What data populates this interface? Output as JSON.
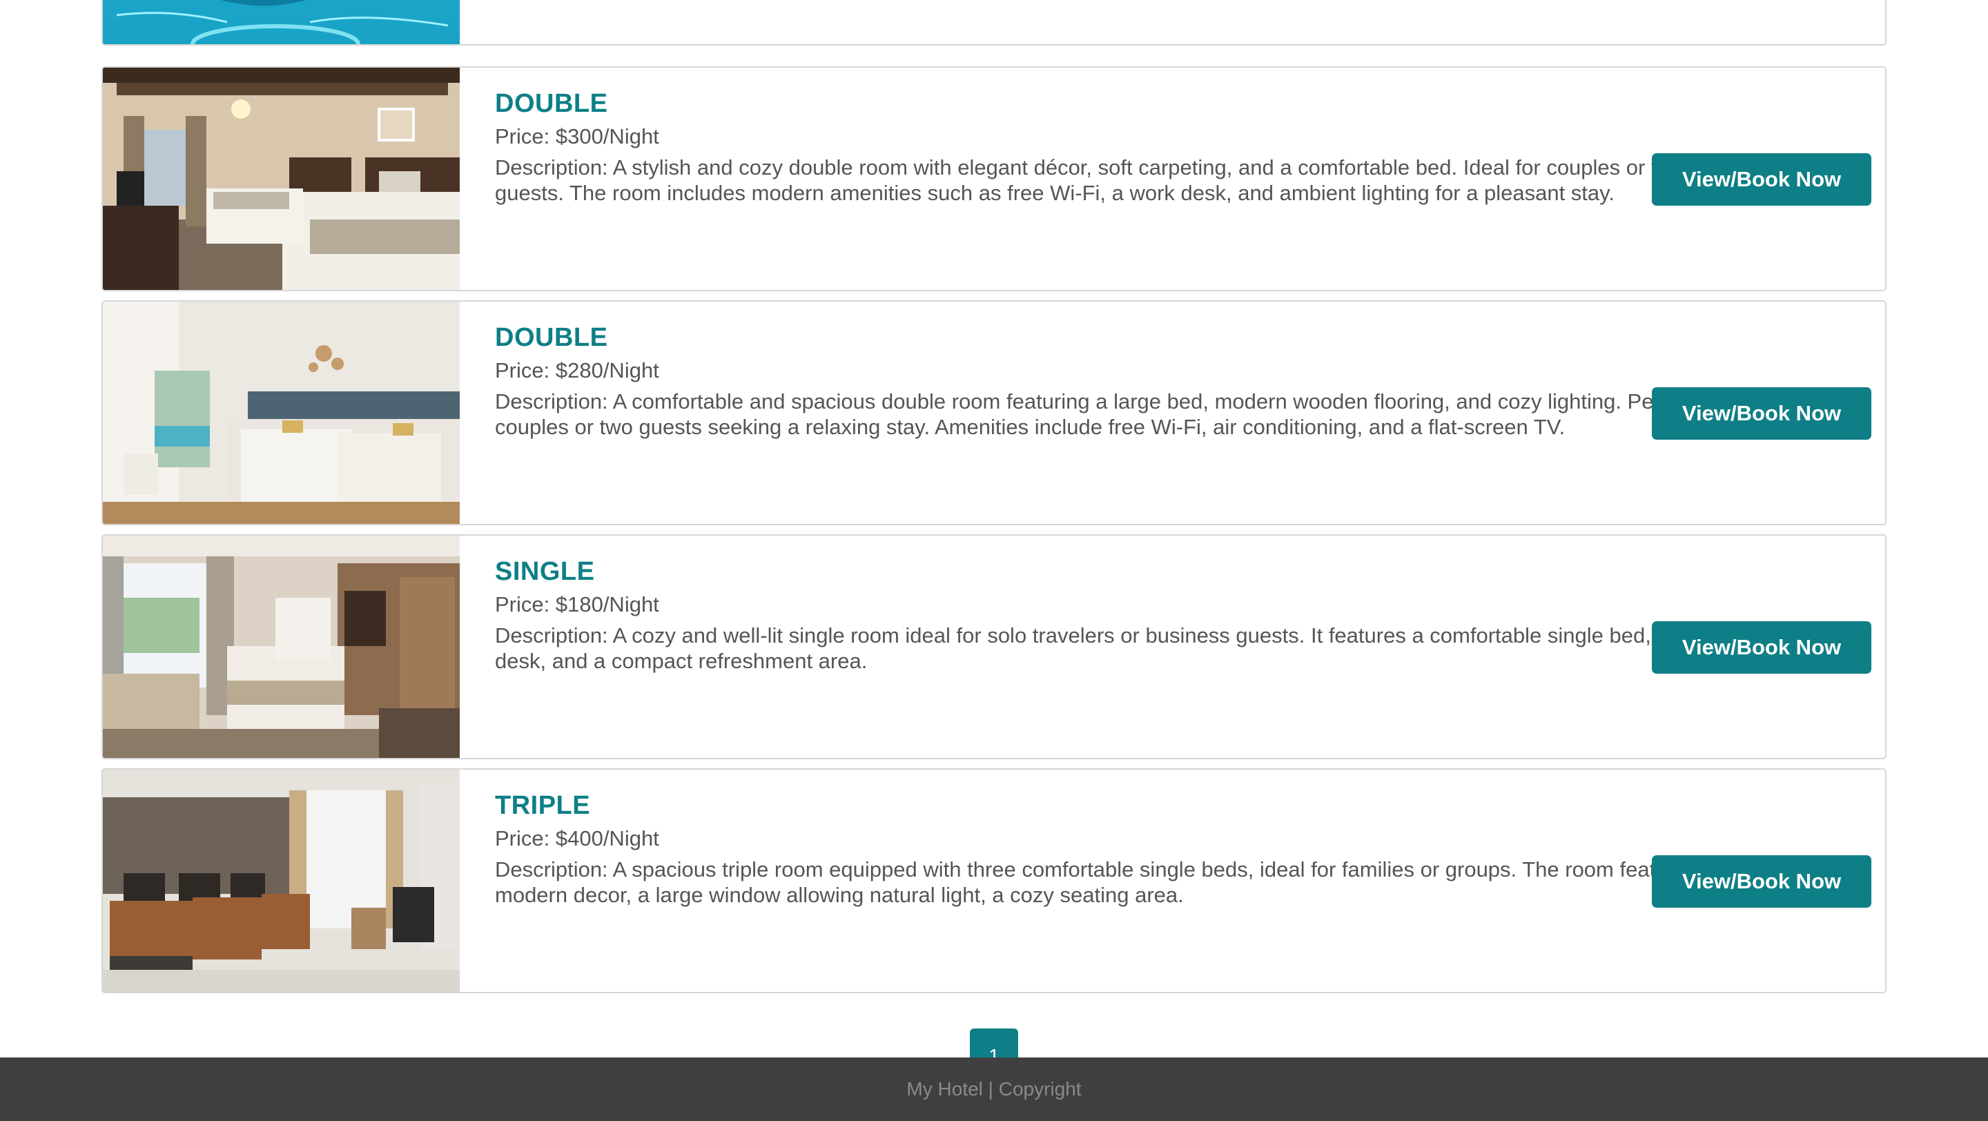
{
  "rooms": [
    {
      "title": "",
      "price": "",
      "description": "",
      "button_label": ""
    },
    {
      "title": "DOUBLE",
      "price": "Price: $300/Night",
      "description": "Description: A stylish and cozy double room with elegant décor, soft carpeting, and a comfortable bed. Ideal for couples or two guests. The room includes modern amenities such as free Wi-Fi, a work desk, and ambient lighting for a pleasant stay.",
      "button_label": "View/Book Now"
    },
    {
      "title": "DOUBLE",
      "price": "Price: $280/Night",
      "description": "Description: A comfortable and spacious double room featuring a large bed, modern wooden flooring, and cozy lighting. Perfect for couples or two guests seeking a relaxing stay. Amenities include free Wi-Fi, air conditioning, and a flat-screen TV.",
      "button_label": "View/Book Now"
    },
    {
      "title": "SINGLE",
      "price": "Price: $180/Night",
      "description": "Description: A cozy and well-lit single room ideal for solo travelers or business guests. It features a comfortable single bed, a work desk, and a compact refreshment area.",
      "button_label": "View/Book Now"
    },
    {
      "title": "TRIPLE",
      "price": "Price: $400/Night",
      "description": "Description: A spacious triple room equipped with three comfortable single beds, ideal for families or groups. The room features modern decor, a large window allowing natural light, a cozy seating area.",
      "button_label": "View/Book Now"
    }
  ],
  "pagination": {
    "current_page": "1"
  },
  "footer": {
    "text": "My Hotel | Copyright"
  },
  "colors": {
    "accent": "#0e7f86",
    "footer_bg": "#3f3f3f",
    "text": "#555555"
  }
}
